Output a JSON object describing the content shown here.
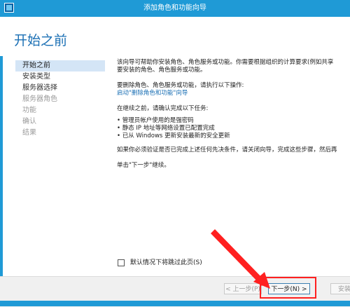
{
  "window": {
    "title": "添加角色和功能向导"
  },
  "page": {
    "title": "开始之前"
  },
  "nav": {
    "items": [
      {
        "label": "开始之前",
        "state": "active"
      },
      {
        "label": "安装类型",
        "state": "normal"
      },
      {
        "label": "服务器选择",
        "state": "normal"
      },
      {
        "label": "服务器角色",
        "state": "disabled"
      },
      {
        "label": "功能",
        "state": "disabled"
      },
      {
        "label": "确认",
        "state": "disabled"
      },
      {
        "label": "结果",
        "state": "disabled"
      }
    ]
  },
  "content": {
    "intro_line1": "该向导可帮助你安装角色、角色服务或功能。你需要根据组织的计算要求(例如共享",
    "intro_line2": "要安装的角色、角色服务或功能。",
    "remove_text": "要删除角色、角色服务或功能，请执行以下操作:",
    "remove_link": "启动\"删除角色和功能\"向导",
    "prereq_heading": "在继续之前，请确认完成以下任务:",
    "bullets": [
      "管理员帐户使用的是强密码",
      "静态 IP 地址等网络设置已配置完成",
      "已从 Windows 更新安装最新的安全更新"
    ],
    "verify_text": "如果你必须验证是否已完成上述任何先决条件，请关闭向导，完成这些步骤，然后再",
    "click_next": "单击\"下一步\"继续。"
  },
  "skip_checkbox": {
    "label": "默认情况下将跳过此页(S)",
    "checked": false
  },
  "footer": {
    "prev_label": "< 上一步(P)",
    "next_label": "下一步(N) >",
    "install_label": "安装"
  },
  "colors": {
    "titlebar": "#1f9ad6",
    "title_text": "#1a6fb4",
    "nav_active": "#d4e5f6",
    "annotation": "#ff2020"
  }
}
